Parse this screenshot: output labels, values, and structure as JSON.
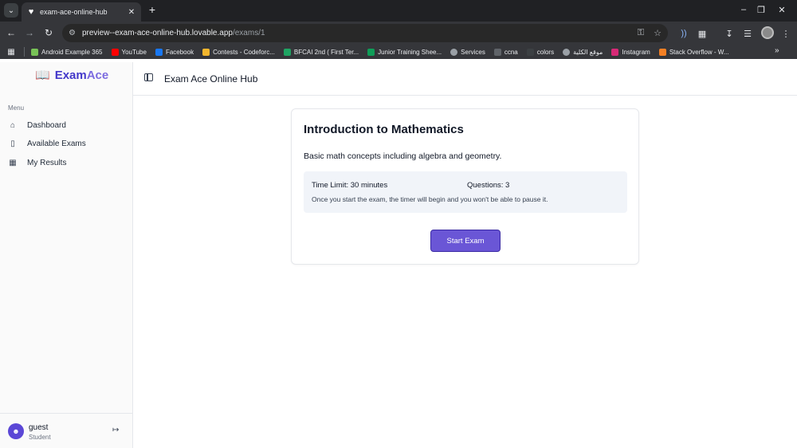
{
  "browser": {
    "tab": {
      "title": "exam-ace-online-hub",
      "favicon": "heart-icon"
    },
    "url": {
      "prefix": "preview--exam-ace-online-hub.lovable.app",
      "path": "/exams/1"
    },
    "bookmarks": [
      {
        "label": "Android Example 365",
        "color": "#78c257"
      },
      {
        "label": "YouTube",
        "color": "#ff0000"
      },
      {
        "label": "Facebook",
        "color": "#1877f2"
      },
      {
        "label": "Contests - Codeforc...",
        "color": "#f3b62e"
      },
      {
        "label": "BFCAI 2nd ( First Ter...",
        "color": "#1fa463"
      },
      {
        "label": "Junior Training Shee...",
        "color": "#0f9d58"
      },
      {
        "label": "Services",
        "color": "#9aa0a6"
      },
      {
        "label": "ccna",
        "color": "#5f6368"
      },
      {
        "label": "colors",
        "color": "#3c4043"
      },
      {
        "label": "موقع الكلية",
        "color": "#9aa0a6"
      },
      {
        "label": "Instagram",
        "color": "#d62976"
      },
      {
        "label": "Stack Overflow - W...",
        "color": "#f48024"
      }
    ]
  },
  "sidebar": {
    "brand": {
      "part1": "Exam",
      "part2": "Ace"
    },
    "menu_label": "Menu",
    "items": [
      {
        "label": "Dashboard",
        "icon": "home-icon"
      },
      {
        "label": "Available Exams",
        "icon": "book-icon"
      },
      {
        "label": "My Results",
        "icon": "grid-icon"
      }
    ],
    "user": {
      "name": "guest",
      "role": "Student"
    }
  },
  "header": {
    "title": "Exam Ace Online Hub"
  },
  "exam": {
    "title": "Introduction to Mathematics",
    "description": "Basic math concepts including algebra and geometry.",
    "time_limit": "Time Limit: 30 minutes",
    "questions": "Questions: 3",
    "notice": "Once you start the exam, the timer will begin and you won't be able to pause it.",
    "start_label": "Start Exam"
  },
  "colors": {
    "accent": "#6a56d6",
    "brand": "#4338ca"
  }
}
